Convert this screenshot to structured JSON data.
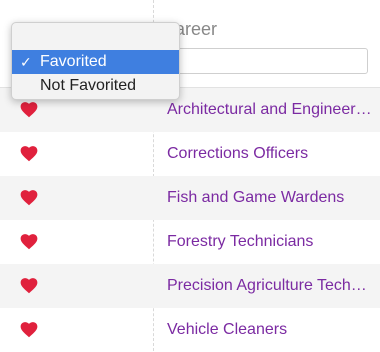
{
  "header": {
    "career_label": "Career"
  },
  "filter": {
    "value": ""
  },
  "favorite_dropdown": {
    "options": [
      {
        "label": "Favorited",
        "selected": true
      },
      {
        "label": "Not Favorited",
        "selected": false
      }
    ],
    "checkmark": "✓"
  },
  "rows": [
    {
      "favorited": true,
      "career": "Architectural and Engineering Managers"
    },
    {
      "favorited": true,
      "career": "Corrections Officers"
    },
    {
      "favorited": true,
      "career": "Fish and Game Wardens"
    },
    {
      "favorited": true,
      "career": "Forestry Technicians"
    },
    {
      "favorited": true,
      "career": "Precision Agriculture Technicians"
    },
    {
      "favorited": true,
      "career": "Vehicle Cleaners"
    }
  ],
  "colors": {
    "heart": "#e0213d",
    "career_link": "#7b2aa2",
    "selected_option_bg": "#3f7fe0"
  },
  "icons": {
    "favorite": "heart-icon"
  }
}
